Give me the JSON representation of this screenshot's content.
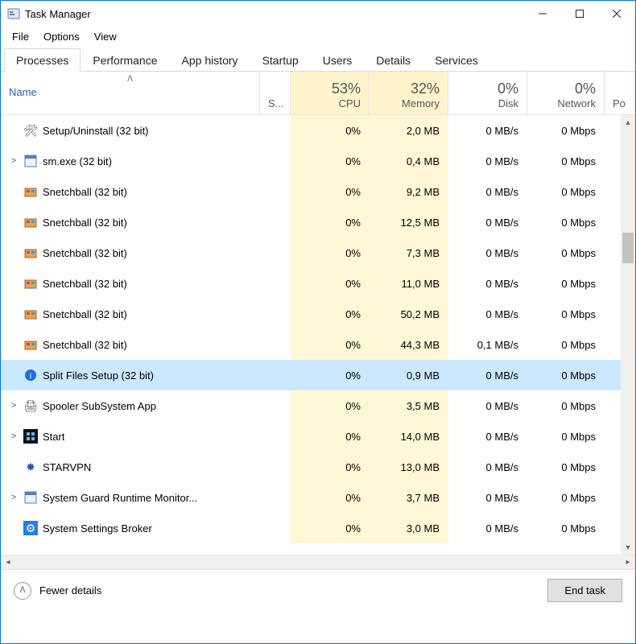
{
  "window": {
    "title": "Task Manager"
  },
  "menu": {
    "file": "File",
    "options": "Options",
    "view": "View"
  },
  "tabs": [
    {
      "label": "Processes",
      "active": true
    },
    {
      "label": "Performance",
      "active": false
    },
    {
      "label": "App history",
      "active": false
    },
    {
      "label": "Startup",
      "active": false
    },
    {
      "label": "Users",
      "active": false
    },
    {
      "label": "Details",
      "active": false
    },
    {
      "label": "Services",
      "active": false
    }
  ],
  "columns": {
    "name": "Name",
    "status": "S...",
    "cpu": {
      "pct": "53%",
      "label": "CPU"
    },
    "memory": {
      "pct": "32%",
      "label": "Memory"
    },
    "disk": {
      "pct": "0%",
      "label": "Disk"
    },
    "network": {
      "pct": "0%",
      "label": "Network"
    },
    "power": {
      "label": "Po"
    }
  },
  "rows": [
    {
      "expand": "",
      "icon": "tools-icon",
      "name": "Setup/Uninstall (32 bit)",
      "cpu": "0%",
      "mem": "2,0 MB",
      "disk": "0 MB/s",
      "net": "0 Mbps",
      "selected": false
    },
    {
      "expand": ">",
      "icon": "app-icon",
      "name": "sm.exe (32 bit)",
      "cpu": "0%",
      "mem": "0,4 MB",
      "disk": "0 MB/s",
      "net": "0 Mbps",
      "selected": false
    },
    {
      "expand": "",
      "icon": "game-icon",
      "name": "Snetchball (32 bit)",
      "cpu": "0%",
      "mem": "9,2 MB",
      "disk": "0 MB/s",
      "net": "0 Mbps",
      "selected": false
    },
    {
      "expand": "",
      "icon": "game-icon",
      "name": "Snetchball (32 bit)",
      "cpu": "0%",
      "mem": "12,5 MB",
      "disk": "0 MB/s",
      "net": "0 Mbps",
      "selected": false
    },
    {
      "expand": "",
      "icon": "game-icon",
      "name": "Snetchball (32 bit)",
      "cpu": "0%",
      "mem": "7,3 MB",
      "disk": "0 MB/s",
      "net": "0 Mbps",
      "selected": false
    },
    {
      "expand": "",
      "icon": "game-icon",
      "name": "Snetchball (32 bit)",
      "cpu": "0%",
      "mem": "11,0 MB",
      "disk": "0 MB/s",
      "net": "0 Mbps",
      "selected": false
    },
    {
      "expand": "",
      "icon": "game-icon",
      "name": "Snetchball (32 bit)",
      "cpu": "0%",
      "mem": "50,2 MB",
      "disk": "0 MB/s",
      "net": "0 Mbps",
      "selected": false
    },
    {
      "expand": "",
      "icon": "game-icon",
      "name": "Snetchball (32 bit)",
      "cpu": "0%",
      "mem": "44,3 MB",
      "disk": "0,1 MB/s",
      "net": "0 Mbps",
      "selected": false
    },
    {
      "expand": "",
      "icon": "info-icon",
      "name": "Split Files Setup (32 bit)",
      "cpu": "0%",
      "mem": "0,9 MB",
      "disk": "0 MB/s",
      "net": "0 Mbps",
      "selected": true
    },
    {
      "expand": ">",
      "icon": "printer-icon",
      "name": "Spooler SubSystem App",
      "cpu": "0%",
      "mem": "3,5 MB",
      "disk": "0 MB/s",
      "net": "0 Mbps",
      "selected": false
    },
    {
      "expand": ">",
      "icon": "start-icon",
      "name": "Start",
      "cpu": "0%",
      "mem": "14,0 MB",
      "disk": "0 MB/s",
      "net": "0 Mbps",
      "selected": false
    },
    {
      "expand": "",
      "icon": "star-icon",
      "name": "STARVPN",
      "cpu": "0%",
      "mem": "13,0 MB",
      "disk": "0 MB/s",
      "net": "0 Mbps",
      "selected": false
    },
    {
      "expand": ">",
      "icon": "app-icon",
      "name": "System Guard Runtime Monitor...",
      "cpu": "0%",
      "mem": "3,7 MB",
      "disk": "0 MB/s",
      "net": "0 Mbps",
      "selected": false
    },
    {
      "expand": "",
      "icon": "gear-icon",
      "name": "System Settings Broker",
      "cpu": "0%",
      "mem": "3,0 MB",
      "disk": "0 MB/s",
      "net": "0 Mbps",
      "selected": false
    }
  ],
  "footer": {
    "fewer_details": "Fewer details",
    "end_task": "End task"
  }
}
